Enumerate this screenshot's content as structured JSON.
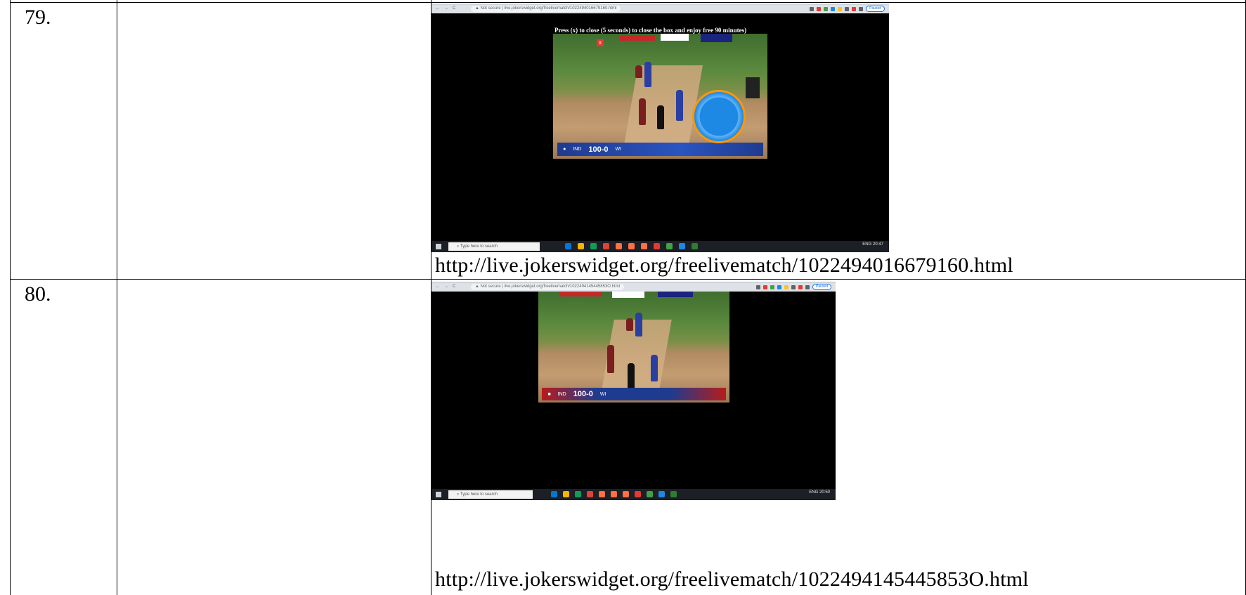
{
  "rows": [
    {
      "number": "79.",
      "url": "http://live.jokerswidget.org/freelivematch/1022494016679160.html",
      "screenshot": {
        "address_bar": "Not secure | live.jokerswidget.org/freelivematch/1022494016679160.html",
        "overlay_text": "Press (x) to close (5 seconds) to close the box and enjoy free 90 minutes)",
        "scoreboard": "100-0",
        "taskbar_search": "Type here to search",
        "tray_time": "20:47",
        "tray_lang": "ENG",
        "pause_label": "Paused"
      }
    },
    {
      "number": "80.",
      "url": "http://live.jokerswidget.org/freelivematch/1022494145445853O.html",
      "screenshot": {
        "address_bar": "Not secure | live.jokerswidget.org/freelivematch/1022494145445853O.html",
        "scoreboard": "100-0",
        "taskbar_search": "Type here to search",
        "tray_time": "20:50",
        "tray_lang": "ENG",
        "pause_label": "Paused"
      }
    }
  ],
  "colors": {
    "border": "#000000",
    "chrome": "#dee1e6",
    "scoreboard": "#2a54c0",
    "bell": "#1e88e5",
    "bell_ring": "#ff9800",
    "taskbar": "#1c1f26"
  },
  "icons": [
    "back-icon",
    "forward-icon",
    "reload-icon",
    "warning-icon",
    "close-icon",
    "bell-icon",
    "windows-icon",
    "search-icon"
  ]
}
